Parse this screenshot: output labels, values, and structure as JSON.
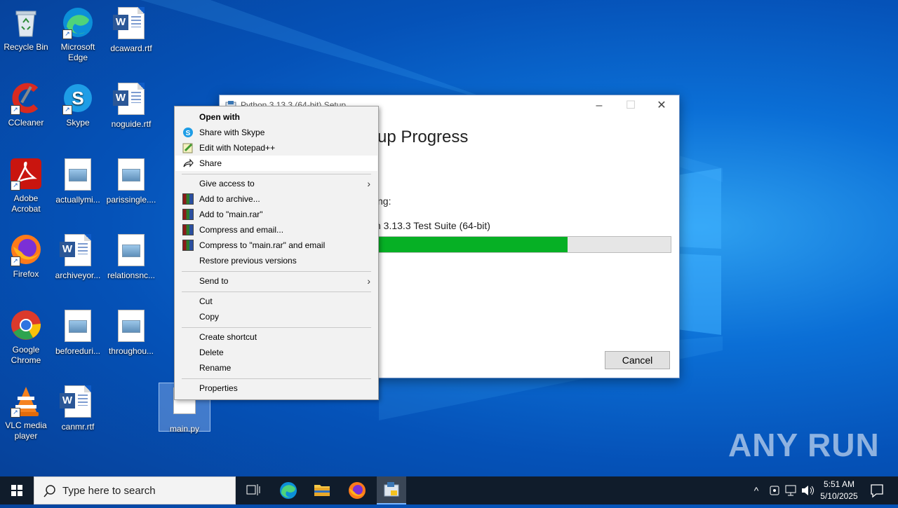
{
  "desktop": {
    "icons": [
      {
        "label": "Recycle Bin"
      },
      {
        "label": "Microsoft Edge"
      },
      {
        "label": "dcaward.rtf"
      },
      {
        "label": "CCleaner"
      },
      {
        "label": "Skype"
      },
      {
        "label": "noguide.rtf"
      },
      {
        "label": "Adobe Acrobat"
      },
      {
        "label": "actuallymi..."
      },
      {
        "label": "parissingle...."
      },
      {
        "label": "Firefox"
      },
      {
        "label": "archiveyor..."
      },
      {
        "label": "relationsnc..."
      },
      {
        "label": "Google Chrome"
      },
      {
        "label": "beforeduri..."
      },
      {
        "label": "throughou..."
      },
      {
        "label": "VLC media player"
      },
      {
        "label": "canmr.rtf"
      },
      {
        "label": "main.py"
      }
    ]
  },
  "setup_window": {
    "title": "Python 3.13.3 (64-bit) Setup",
    "heading": "up Progress",
    "status": "ng:",
    "current_item": "n 3.13.3 Test Suite (64-bit)",
    "progress_percent": 65,
    "cancel_label": "Cancel"
  },
  "context_menu": {
    "items": [
      {
        "label": "Open with"
      },
      {
        "label": "Share with Skype"
      },
      {
        "label": "Edit with Notepad++"
      },
      {
        "label": "Share"
      },
      {
        "label": "Give access to"
      },
      {
        "label": "Add to archive..."
      },
      {
        "label": "Add to \"main.rar\""
      },
      {
        "label": "Compress and email..."
      },
      {
        "label": "Compress to \"main.rar\" and email"
      },
      {
        "label": "Restore previous versions"
      },
      {
        "label": "Send to"
      },
      {
        "label": "Cut"
      },
      {
        "label": "Copy"
      },
      {
        "label": "Create shortcut"
      },
      {
        "label": "Delete"
      },
      {
        "label": "Rename"
      },
      {
        "label": "Properties"
      }
    ]
  },
  "taskbar": {
    "search_placeholder": "Type here to search",
    "time": "5:51 AM",
    "date": "5/10/2025"
  },
  "watermark": "ANY RUN"
}
